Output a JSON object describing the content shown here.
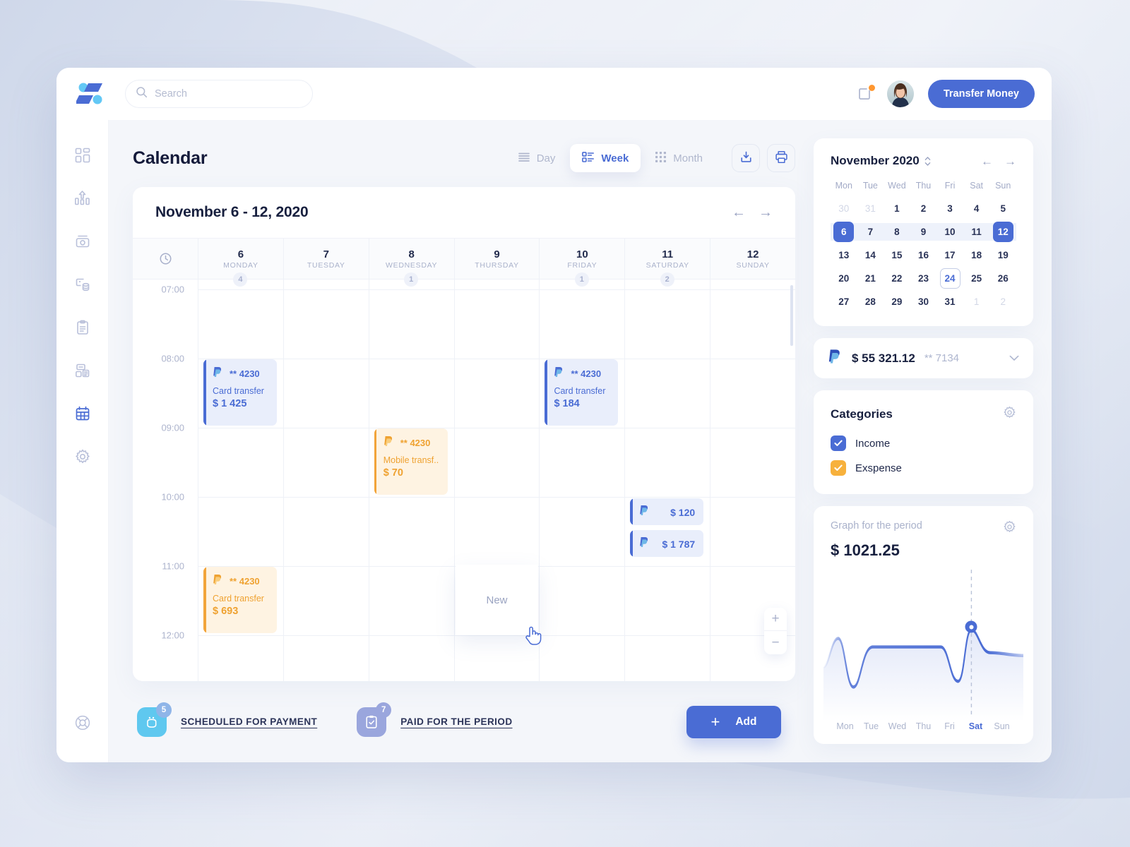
{
  "colors": {
    "primary": "#4a6cd4",
    "accent_orange": "#f2a43a",
    "notification": "#ff9730",
    "text_dark": "#18203f",
    "text_muted": "#aab2cb",
    "surface": "#ffffff",
    "canvas": "#f4f6fa"
  },
  "topbar": {
    "logo_name": "app-logo",
    "search": {
      "value": "",
      "placeholder": "Search"
    },
    "notification_icon": "notification-icon",
    "avatar_alt": "user-avatar",
    "transfer_label": "Transfer Money"
  },
  "sidebar": {
    "items": [
      {
        "name": "dashboard",
        "icon": "dashboard-icon",
        "active": false
      },
      {
        "name": "analytics",
        "icon": "analytics-chart-icon",
        "active": false
      },
      {
        "name": "wallet",
        "icon": "wallet-icon",
        "active": false
      },
      {
        "name": "transactions",
        "icon": "transactions-database-icon",
        "active": false
      },
      {
        "name": "reports",
        "icon": "clipboard-document-icon",
        "active": false
      },
      {
        "name": "accounts",
        "icon": "accounts-icon",
        "active": false
      },
      {
        "name": "calendar",
        "icon": "calendar-icon",
        "active": true
      },
      {
        "name": "settings",
        "icon": "gear-icon",
        "active": false
      }
    ],
    "bottom_item": {
      "name": "support",
      "icon": "lifebuoy-icon"
    }
  },
  "main": {
    "page_title": "Calendar",
    "views": [
      {
        "label": "Day",
        "icon": "list-lines-icon",
        "active": false
      },
      {
        "label": "Week",
        "icon": "list-blocks-icon",
        "active": true
      },
      {
        "label": "Month",
        "icon": "grid-dots-icon",
        "active": false
      }
    ],
    "actions": [
      {
        "name": "export-button",
        "icon": "download-tray-icon"
      },
      {
        "name": "print-button",
        "icon": "printer-icon"
      }
    ]
  },
  "calendar": {
    "range_title": "November 6 - 12, 2020",
    "prev_label": "←",
    "next_label": "→",
    "clock_icon": "clock-icon",
    "days": [
      {
        "num": "6",
        "name": "MONDAY",
        "count": "4"
      },
      {
        "num": "7",
        "name": "TUESDAY",
        "count": ""
      },
      {
        "num": "8",
        "name": "WEDNESDAY",
        "count": "1"
      },
      {
        "num": "9",
        "name": "THURSDAY",
        "count": ""
      },
      {
        "num": "10",
        "name": "FRIDAY",
        "count": "1"
      },
      {
        "num": "11",
        "name": "SATURDAY",
        "count": "2"
      },
      {
        "num": "12",
        "name": "SUNDAY",
        "count": ""
      }
    ],
    "times": [
      "07:00",
      "08:00",
      "09:00",
      "10:00",
      "11:00",
      "12:00"
    ],
    "events": [
      {
        "day": 0,
        "time": "08:00",
        "provider": "paypal",
        "mask": "** 4230",
        "desc": "Card transfer",
        "amount": "$ 1 425",
        "type": "blue",
        "layout": "full"
      },
      {
        "day": 4,
        "time": "08:00",
        "provider": "paypal",
        "mask": "** 4230",
        "desc": "Card transfer",
        "amount": "$ 184",
        "type": "blue",
        "layout": "full"
      },
      {
        "day": 2,
        "time": "09:00",
        "provider": "paypal",
        "mask": "** 4230",
        "desc": "Mobile transf..",
        "amount": "$ 70",
        "type": "orange",
        "layout": "full"
      },
      {
        "day": 5,
        "time": "10:00",
        "provider": "paypal",
        "mask": "",
        "desc": "",
        "amount": "$ 120",
        "type": "blue",
        "layout": "compact"
      },
      {
        "day": 5,
        "time": "10:30",
        "provider": "paypal",
        "mask": "",
        "desc": "",
        "amount": "$ 1 787",
        "type": "blue",
        "layout": "compact"
      },
      {
        "day": 0,
        "time": "11:00",
        "provider": "paypal",
        "mask": "** 4230",
        "desc": "Card transfer",
        "amount": "$ 693",
        "type": "orange",
        "layout": "full"
      }
    ],
    "new_event_label": "New",
    "zoom_in_label": "+",
    "zoom_out_label": "−"
  },
  "footer": {
    "legends": [
      {
        "label": "SCHEDULED FOR PAYMENT",
        "count": "5",
        "icon": "bag-scheduled-icon",
        "color": "#5fc8ef",
        "badge_color": "#8fb5e8"
      },
      {
        "label": "PAID FOR THE PERIOD",
        "count": "7",
        "icon": "clipboard-check-icon",
        "color": "#9aa6dd",
        "badge_color": "#9aa6dd"
      }
    ],
    "add_label": "Add",
    "add_plus": "+"
  },
  "mini_calendar": {
    "title": "November 2020",
    "spinner_icon": "stepper-updown-icon",
    "prev_label": "←",
    "next_label": "→",
    "dow": [
      "Mon",
      "Tue",
      "Wed",
      "Thu",
      "Fri",
      "Sat",
      "Sun"
    ],
    "weeks": [
      [
        {
          "d": "30",
          "s": "mute"
        },
        {
          "d": "31",
          "s": "mute"
        },
        {
          "d": "1",
          "s": ""
        },
        {
          "d": "2",
          "s": ""
        },
        {
          "d": "3",
          "s": ""
        },
        {
          "d": "4",
          "s": ""
        },
        {
          "d": "5",
          "s": ""
        }
      ],
      [
        {
          "d": "6",
          "s": "sel"
        },
        {
          "d": "7",
          "s": "inrange"
        },
        {
          "d": "8",
          "s": "inrange"
        },
        {
          "d": "9",
          "s": "inrange"
        },
        {
          "d": "10",
          "s": "inrange"
        },
        {
          "d": "11",
          "s": "inrange"
        },
        {
          "d": "12",
          "s": "sel"
        }
      ],
      [
        {
          "d": "13",
          "s": ""
        },
        {
          "d": "14",
          "s": ""
        },
        {
          "d": "15",
          "s": ""
        },
        {
          "d": "16",
          "s": ""
        },
        {
          "d": "17",
          "s": ""
        },
        {
          "d": "18",
          "s": ""
        },
        {
          "d": "19",
          "s": ""
        }
      ],
      [
        {
          "d": "20",
          "s": ""
        },
        {
          "d": "21",
          "s": ""
        },
        {
          "d": "22",
          "s": ""
        },
        {
          "d": "23",
          "s": ""
        },
        {
          "d": "24",
          "s": "today"
        },
        {
          "d": "25",
          "s": ""
        },
        {
          "d": "26",
          "s": ""
        }
      ],
      [
        {
          "d": "27",
          "s": ""
        },
        {
          "d": "28",
          "s": ""
        },
        {
          "d": "29",
          "s": ""
        },
        {
          "d": "30",
          "s": ""
        },
        {
          "d": "31",
          "s": ""
        },
        {
          "d": "1",
          "s": "mute"
        },
        {
          "d": "2",
          "s": "mute"
        }
      ]
    ]
  },
  "account": {
    "provider_icon": "paypal-icon",
    "balance": "$ 55 321.12",
    "mask": "** 7134",
    "chevron": "chevron-down-icon"
  },
  "categories": {
    "title": "Categories",
    "gear_icon": "gear-icon",
    "items": [
      {
        "label": "Income",
        "checked": true,
        "color": "#4a6cd4"
      },
      {
        "label": "Exspense",
        "checked": true,
        "color": "#f7b13c"
      }
    ]
  },
  "graph": {
    "label": "Graph for the period",
    "gear_icon": "gear-icon",
    "amount": "$ 1021.25",
    "axis": [
      "Mon",
      "Tue",
      "Wed",
      "Thu",
      "Fri",
      "Sat",
      "Sun"
    ],
    "highlight_day": "Sat"
  },
  "chart_data": {
    "type": "line",
    "title": "Graph for the period",
    "x": [
      "Mon",
      "Tue",
      "Wed",
      "Thu",
      "Fri",
      "Sat",
      "Sun"
    ],
    "values": [
      0.42,
      0.18,
      0.62,
      0.62,
      0.28,
      0.92,
      0.6
    ],
    "highlight": {
      "x": "Sat",
      "value": 0.92,
      "label": "$ 1021.25"
    },
    "xlabel": "",
    "ylabel": "",
    "grid": false,
    "legend": false,
    "line_color": "#4a6cd4",
    "fill": "gradient-blue-fade"
  }
}
